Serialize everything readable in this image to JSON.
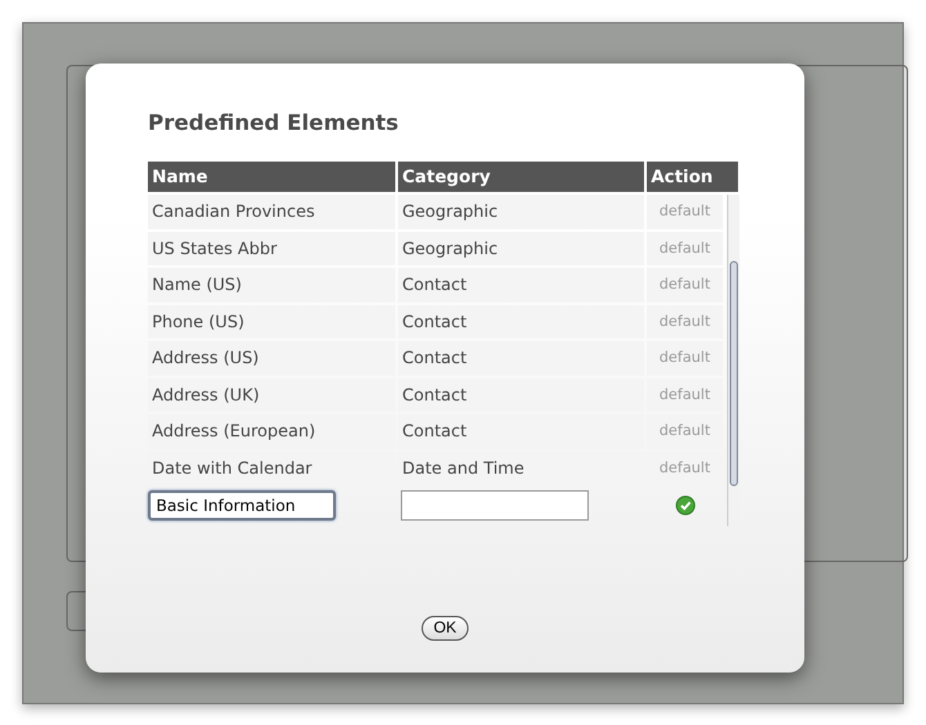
{
  "dialog": {
    "title": "Predefined Elements",
    "table": {
      "columns": [
        "Name",
        "Category",
        "Action"
      ],
      "rows": [
        {
          "name": "Canadian Provinces",
          "category": "Geographic",
          "action": "default"
        },
        {
          "name": "US States Abbr",
          "category": "Geographic",
          "action": "default"
        },
        {
          "name": "Name (US)",
          "category": "Contact",
          "action": "default"
        },
        {
          "name": "Phone (US)",
          "category": "Contact",
          "action": "default"
        },
        {
          "name": "Address (US)",
          "category": "Contact",
          "action": "default"
        },
        {
          "name": "Address (UK)",
          "category": "Contact",
          "action": "default"
        },
        {
          "name": "Address (European)",
          "category": "Contact",
          "action": "default"
        },
        {
          "name": "Date with Calendar",
          "category": "Date and Time",
          "action": "default"
        }
      ],
      "new_row": {
        "name_value": "Basic Information"
      }
    },
    "buttons": [
      "OK"
    ]
  }
}
